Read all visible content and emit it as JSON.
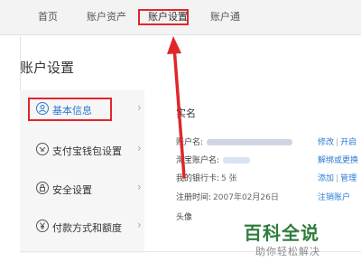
{
  "topnav": {
    "tabs": [
      "首页",
      "账户资产",
      "账户设置",
      "账户通"
    ],
    "active_index": 2
  },
  "page_title": "账户设置",
  "sidebar": {
    "items": [
      {
        "label": "基本信息",
        "icon": "user-icon",
        "active": true
      },
      {
        "label": "支付宝钱包设置",
        "icon": "wallet-icon",
        "active": false
      },
      {
        "label": "安全设置",
        "icon": "lock-icon",
        "active": false
      },
      {
        "label": "付款方式和额度",
        "icon": "yuan-icon",
        "active": false
      }
    ]
  },
  "content": {
    "heading": "实名",
    "rows": [
      {
        "key": "账户名:",
        "value": ""
      },
      {
        "key": "淘宝账户名:",
        "value": ""
      },
      {
        "key": "我的银行卡:",
        "value": "5 张"
      },
      {
        "key": "注册时间:",
        "value": "2007年02月26日"
      },
      {
        "key": "头像",
        "value": ""
      }
    ],
    "actions": {
      "row0_a": "修改",
      "row0_sep": "|",
      "row0_b": "开启",
      "row1_a": "解绑或更换",
      "row2_a": "添加",
      "row2_sep": "|",
      "row2_b": "管理",
      "row3_a": "注销账户"
    }
  },
  "watermark": {
    "main": "百科全说",
    "sub": "助你轻松解决"
  },
  "colors": {
    "highlight": "#e0262b",
    "link": "#2a7cd1",
    "watermark": "#2f7d3c"
  }
}
